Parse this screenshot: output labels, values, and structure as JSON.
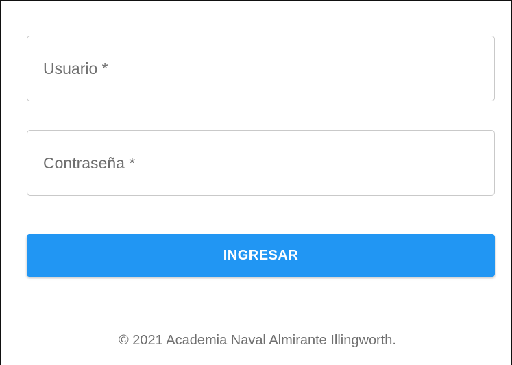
{
  "login_form": {
    "username_placeholder": "Usuario *",
    "password_placeholder": "Contraseña *",
    "submit_label": "INGRESAR"
  },
  "footer": {
    "copyright": "© 2021 Academia Naval Almirante Illingworth."
  },
  "colors": {
    "primary": "#2196f3",
    "field_border": "#c9c9c9",
    "placeholder_text": "#6f6f6f"
  }
}
